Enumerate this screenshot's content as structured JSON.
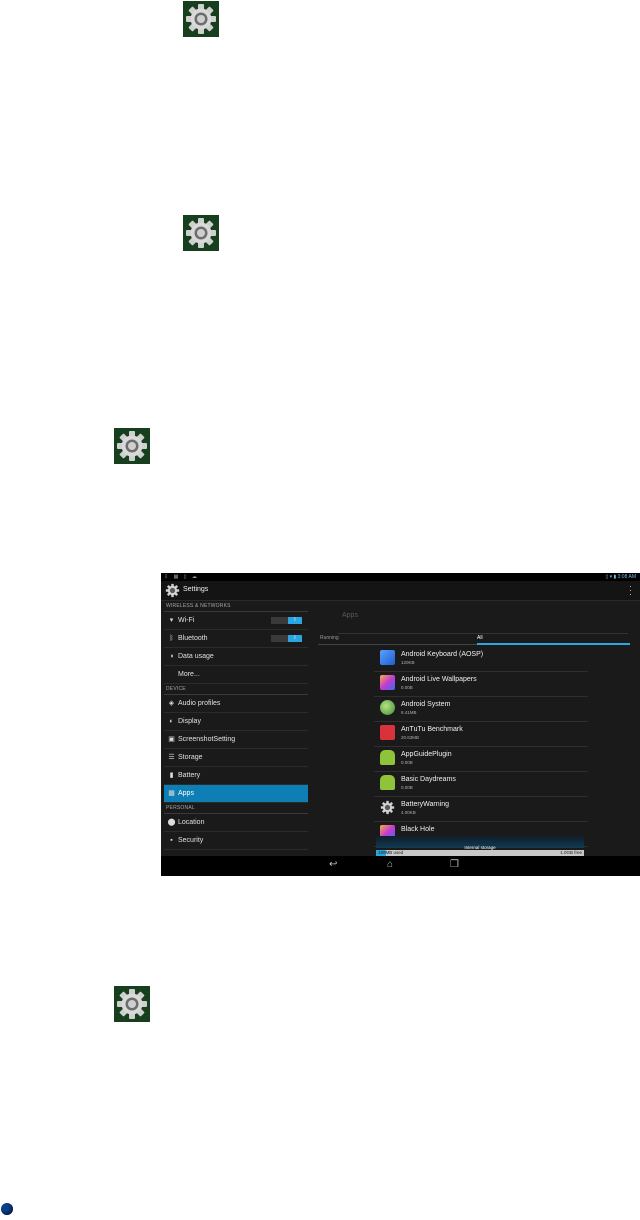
{
  "screen": {
    "status_time": "3:08",
    "status_ampm": "AM",
    "title": "Settings"
  },
  "left": {
    "sections": {
      "wireless": "WIRELESS & NETWORKS",
      "device": "DEVICE",
      "personal": "PERSONAL"
    },
    "items": [
      {
        "label": "Wi-Fi",
        "icon": "wifi-icon",
        "toggle": "I"
      },
      {
        "label": "Bluetooth",
        "icon": "bluetooth-icon",
        "toggle": "I"
      },
      {
        "label": "Data usage",
        "icon": "data-usage-icon"
      },
      {
        "label": "More..."
      },
      {
        "label": "Audio profiles",
        "icon": "audio-icon"
      },
      {
        "label": "Display",
        "icon": "display-icon"
      },
      {
        "label": "ScreenshotSetting",
        "icon": "camera-icon"
      },
      {
        "label": "Storage",
        "icon": "storage-icon"
      },
      {
        "label": "Battery",
        "icon": "battery-icon"
      },
      {
        "label": "Apps",
        "icon": "apps-icon",
        "selected": true
      },
      {
        "label": "Location",
        "icon": "location-icon"
      },
      {
        "label": "Security",
        "icon": "lock-icon"
      }
    ]
  },
  "right": {
    "header": "Apps",
    "tabs": [
      "Running",
      "All"
    ],
    "active_tab": "All",
    "apps": [
      {
        "name": "Android Keyboard (AOSP)",
        "size": "120KB",
        "icon": "keyboard-app-icon"
      },
      {
        "name": "Android Live Wallpapers",
        "size": "0.00B",
        "icon": "wallpaper-app-icon"
      },
      {
        "name": "Android System",
        "size": "8.41MB",
        "icon": "android-system-icon"
      },
      {
        "name": "AnTuTu Benchmark",
        "size": "20.63MB",
        "icon": "antutu-icon"
      },
      {
        "name": "AppGuidePlugin",
        "size": "0.00B",
        "icon": "android-app-icon"
      },
      {
        "name": "Basic Daydreams",
        "size": "0.00B",
        "icon": "android-app-icon"
      },
      {
        "name": "BatteryWarning",
        "size": "4.00KB",
        "icon": "gear-app-icon"
      },
      {
        "name": "Black Hole",
        "size": "",
        "icon": "wallpaper-app-icon"
      }
    ],
    "storage": {
      "label": "Internal storage",
      "used": "199MB used",
      "free": "1.0GB free"
    }
  },
  "colors": {
    "accent": "#2aa6e0",
    "selected_bg": "#0e7fb4",
    "gear_bg": "#173f1e"
  }
}
